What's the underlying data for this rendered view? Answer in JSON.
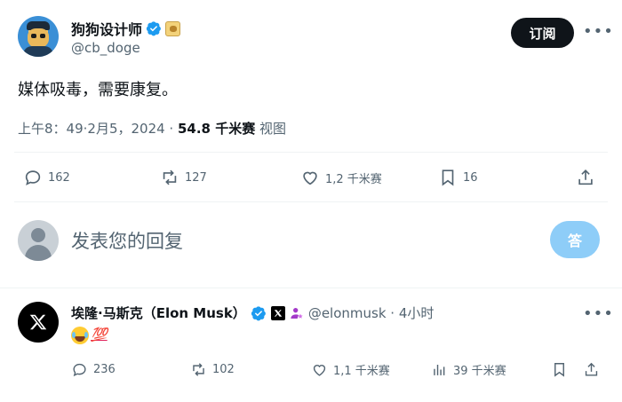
{
  "tweet": {
    "author_name": "狗狗设计师",
    "author_handle": "@cb_doge",
    "subscribe_label": "订阅",
    "more_label": "•••",
    "text": "媒体吸毒，需要康复。",
    "time": "上午8：49·2月5，2024 · ",
    "views_count": "54.8 千米赛",
    "views_label": " 视图",
    "actions": {
      "replies": "162",
      "reposts": "127",
      "likes": "1,2 千米赛",
      "bookmarks": "16"
    }
  },
  "composer": {
    "placeholder": "发表您的回复",
    "reply_button": "答"
  },
  "reply": {
    "author_name": "埃隆·马斯克（Elon Musk）",
    "author_handle": "@elonmusk · 4小时",
    "more_label": "•••",
    "emoji_100": "💯",
    "actions": {
      "replies": "236",
      "reposts": "102",
      "likes": "1,1 千米赛",
      "views": "39 千米赛"
    }
  },
  "colors": {
    "accent": "#1d9bf0",
    "reply_button": "#8ecdf8",
    "text_primary": "#0f1419",
    "text_secondary": "#536471"
  }
}
